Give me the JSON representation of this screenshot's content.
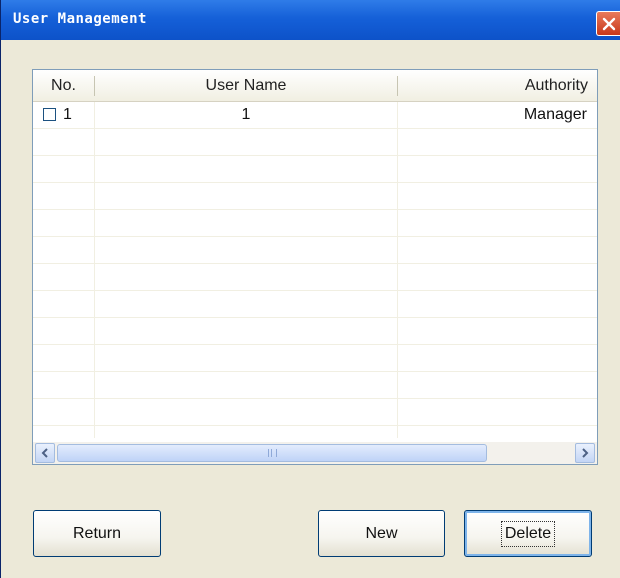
{
  "window": {
    "title": "User Management"
  },
  "table": {
    "columns": [
      "No.",
      "User Name",
      "Authority"
    ],
    "rows": [
      {
        "no": "1",
        "user_name": "1",
        "authority": "Manager",
        "checked": false
      }
    ],
    "empty_rows": 12
  },
  "scrollbar": {
    "left_icon": "chevron-left-icon",
    "right_icon": "chevron-right-icon"
  },
  "buttons": {
    "return_label": "Return",
    "new_label": "New",
    "delete_label": "Delete"
  },
  "colors": {
    "titlebar": "#0d52c9",
    "window_bg": "#ece9d8",
    "close": "#c8381b",
    "border": "#7f9db9"
  }
}
